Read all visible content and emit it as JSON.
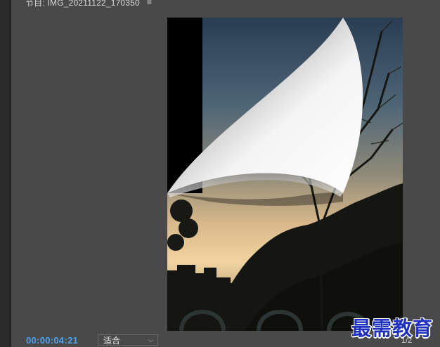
{
  "panel": {
    "title": "节目: IMG_20211122_170350",
    "menu_icon": "≡"
  },
  "viewer": {
    "transition": "page-peel",
    "image_subject": "tree silhouettes at sunset"
  },
  "controls": {
    "timecode": "00:00:04:21",
    "fit_label": "适合",
    "fit_chevron": "⌵",
    "resolution": "1/2"
  },
  "watermark": {
    "text": "最需教育"
  },
  "colors": {
    "panel_bg": "#494949",
    "timecode": "#4da3ee",
    "watermark": "#1f2fbf"
  }
}
